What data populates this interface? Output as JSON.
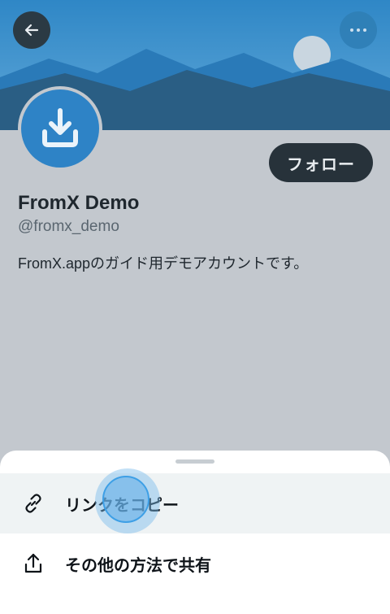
{
  "header": {
    "back_icon": "arrow-left-icon",
    "more_icon": "more-horizontal-icon"
  },
  "profile": {
    "avatar_icon": "download-icon",
    "display_name": "FromX Demo",
    "handle": "@fromx_demo",
    "bio": "FromX.appのガイド用デモアカウントです。",
    "follow_label": "フォロー"
  },
  "sheet": {
    "items": [
      {
        "icon": "link-icon",
        "label": "リンクをコピー"
      },
      {
        "icon": "share-icon",
        "label": "その他の方法で共有"
      }
    ]
  },
  "colors": {
    "accent": "#2e83c6",
    "follow_button": "#27323a",
    "page_dim": "#c3c8ce"
  }
}
